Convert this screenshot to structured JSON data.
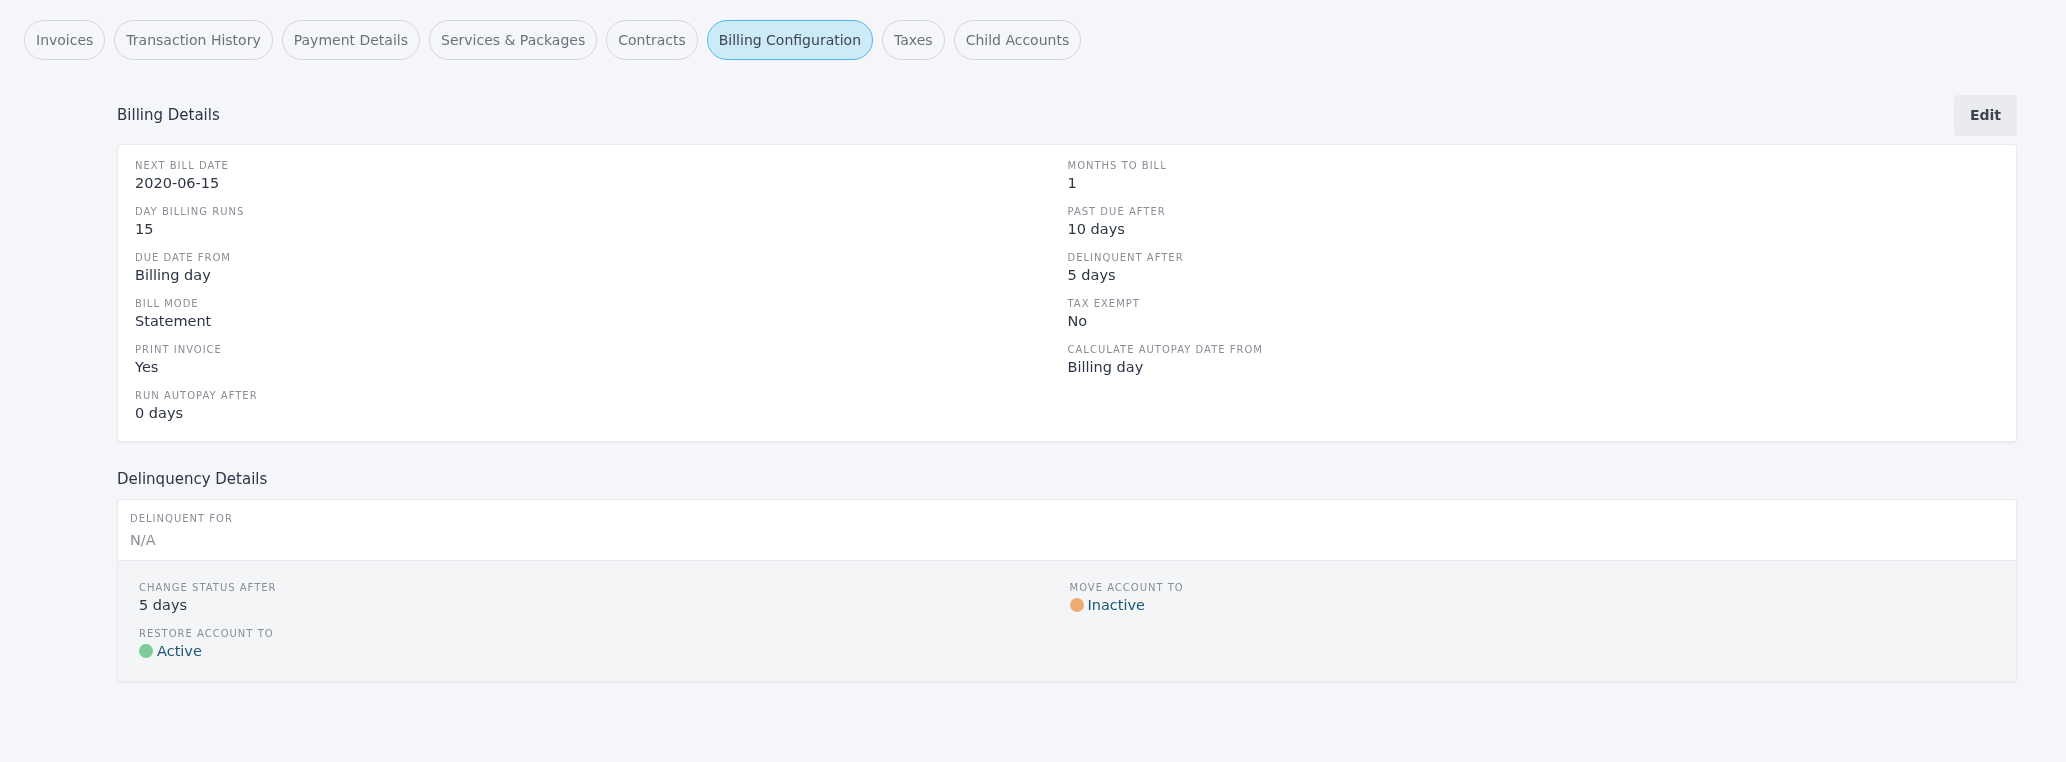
{
  "tabs": [
    {
      "label": "Invoices",
      "selected": false
    },
    {
      "label": "Transaction History",
      "selected": false
    },
    {
      "label": "Payment Details",
      "selected": false
    },
    {
      "label": "Services & Packages",
      "selected": false
    },
    {
      "label": "Contracts",
      "selected": false
    },
    {
      "label": "Billing Configuration",
      "selected": true
    },
    {
      "label": "Taxes",
      "selected": false
    },
    {
      "label": "Child Accounts",
      "selected": false
    }
  ],
  "billing_details": {
    "title": "Billing Details",
    "edit_button": "Edit",
    "columns": [
      [
        {
          "label": "NEXT BILL DATE",
          "value": "2020-06-15"
        },
        {
          "label": "DAY BILLING RUNS",
          "value": "15"
        },
        {
          "label": "DUE DATE FROM",
          "value": "Billing day"
        },
        {
          "label": "BILL MODE",
          "value": "Statement"
        },
        {
          "label": "PRINT INVOICE",
          "value": "Yes"
        },
        {
          "label": "RUN AUTOPAY AFTER",
          "value": "0 days"
        }
      ],
      [
        {
          "label": "MONTHS TO BILL",
          "value": "1"
        },
        {
          "label": "PAST DUE AFTER",
          "value": "10 days"
        },
        {
          "label": "DELINQUENT AFTER",
          "value": "5 days"
        },
        {
          "label": "TAX EXEMPT",
          "value": "No"
        },
        {
          "label": "CALCULATE AUTOPAY DATE FROM",
          "value": "Billing day"
        }
      ]
    ]
  },
  "delinquency_details": {
    "title": "Delinquency Details",
    "delinquent_for": {
      "label": "DELINQUENT FOR",
      "value": "N/A"
    },
    "columns": [
      [
        {
          "label": "CHANGE STATUS AFTER",
          "value": "5 days"
        },
        {
          "label": "RESTORE ACCOUNT TO",
          "value": "Active",
          "color": "#7ccb9a"
        }
      ],
      [
        {
          "label": "MOVE ACCOUNT TO",
          "value": "Inactive",
          "color": "#eeac72"
        }
      ]
    ]
  }
}
